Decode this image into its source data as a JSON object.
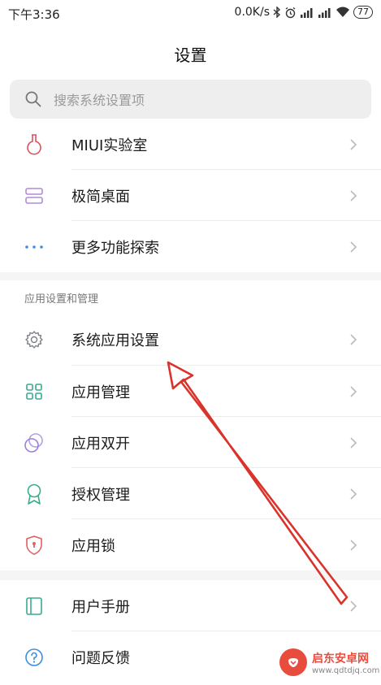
{
  "status_bar": {
    "time": "下午3:36",
    "speed": "0.0K/s",
    "battery": "77"
  },
  "header": {
    "title": "设置"
  },
  "search": {
    "placeholder": "搜索系统设置项"
  },
  "group1": {
    "items": [
      {
        "label": "MIUI实验室",
        "icon": "flask-icon",
        "color": "#d9545d"
      },
      {
        "label": "极简桌面",
        "icon": "desktop-layout-icon",
        "color": "#b48ad8"
      },
      {
        "label": "更多功能探索",
        "icon": "more-dots-icon",
        "color": "#3e8ee0"
      }
    ]
  },
  "section_app": {
    "header": "应用设置和管理",
    "items": [
      {
        "label": "系统应用设置",
        "icon": "gear-icon",
        "color": "#7d8088"
      },
      {
        "label": "应用管理",
        "icon": "grid-icon",
        "color": "#3aab8f"
      },
      {
        "label": "应用双开",
        "icon": "dual-circle-icon",
        "color": "#9b7fd8"
      },
      {
        "label": "授权管理",
        "icon": "ribbon-icon",
        "color": "#3aab8f"
      },
      {
        "label": "应用锁",
        "icon": "shield-lock-icon",
        "color": "#e06060"
      }
    ]
  },
  "group3": {
    "items": [
      {
        "label": "用户手册",
        "icon": "book-icon",
        "color": "#3aab8f"
      },
      {
        "label": "问题反馈",
        "icon": "help-icon",
        "color": "#3e8ee0"
      }
    ]
  },
  "annotation": {
    "color": "#d9342b"
  },
  "watermark": {
    "name": "启东安卓网",
    "url": "www.qdtdjq.com"
  }
}
